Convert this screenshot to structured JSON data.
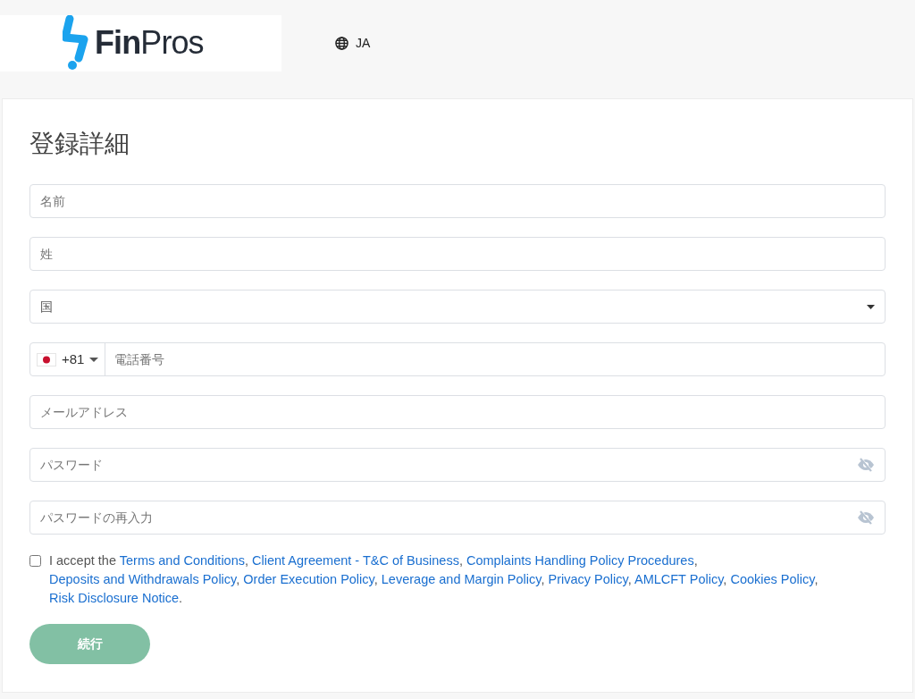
{
  "header": {
    "logo": {
      "bold": "Fin",
      "light": "Pros"
    },
    "language": "JA"
  },
  "form": {
    "title": "登録詳細",
    "fields": [
      {
        "kind": "text",
        "placeholder": "名前"
      },
      {
        "kind": "text",
        "placeholder": "姓"
      },
      {
        "kind": "select",
        "placeholder": "国"
      },
      {
        "kind": "phone",
        "code": "+81",
        "placeholder": "電話番号"
      },
      {
        "kind": "text",
        "placeholder": "メールアドレス"
      },
      {
        "kind": "password",
        "placeholder": "パスワード"
      },
      {
        "kind": "password",
        "placeholder": "パスワードの再入力"
      }
    ],
    "consent": {
      "checked": false,
      "lead": "I accept the",
      "links": [
        "Terms and Conditions",
        "Client Agreement - T&C of Business",
        "Complaints Handling Policy Procedures",
        "Deposits and Withdrawals Policy",
        "Order Execution Policy",
        "Leverage and Margin Policy",
        "Privacy Policy",
        "AMLCFT Policy",
        "Cookies Policy",
        "Risk Disclosure Notice"
      ],
      "separator": ",",
      "end": "."
    },
    "submit": {
      "label": "続行",
      "disabled": true
    }
  }
}
